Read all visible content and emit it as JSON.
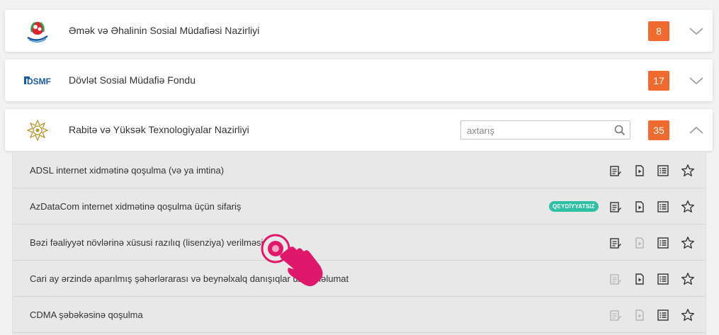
{
  "colors": {
    "badge": "#ef6a2e",
    "badge_tag": "#2ebfa5",
    "accent_pink": "#e0186c",
    "icon_gray": "#333333"
  },
  "organizations": [
    {
      "title": "Əmək və Əhalinin Sosial Müdafiəsi Nazirliyi",
      "count": "8",
      "expanded": false,
      "chevron": "chevron-down-icon"
    },
    {
      "title": "Dövlət Sosial Müdafiə Fondu",
      "count": "17",
      "expanded": false,
      "chevron": "chevron-down-icon",
      "logo_text": "DSMF"
    },
    {
      "title": "Rabitə və Yüksək Texnologiyalar Nazirliyi",
      "count": "35",
      "expanded": true,
      "chevron": "chevron-up-icon",
      "search": {
        "placeholder": "axtarış",
        "value": ""
      }
    }
  ],
  "services": [
    {
      "title": "ADSL internet xidmətinə qoşulma (və ya imtina)",
      "badge": "",
      "actions_enabled": [
        true,
        true,
        true,
        true
      ]
    },
    {
      "title": "AzDataCom internet xidmətinə qoşulma üçün sifariş",
      "badge": "QEYDİYYATSIZ",
      "actions_enabled": [
        true,
        true,
        true,
        true
      ]
    },
    {
      "title": "Bəzi fəaliyyət növlərinə xüsusi razılıq (lisenziya) verilməsi",
      "badge": "",
      "actions_enabled": [
        true,
        false,
        true,
        true
      ]
    },
    {
      "title": "Cari ay ərzində aparılmış şəhərlərarası və beynəlxalq danışıqlar üzrə məlumat",
      "badge": "",
      "actions_enabled": [
        false,
        true,
        true,
        true
      ]
    },
    {
      "title": "CDMA şəbəkəsinə qoşulma",
      "badge": "",
      "actions_enabled": [
        false,
        false,
        true,
        true
      ]
    }
  ],
  "action_icons": [
    "form-edit-icon",
    "video-play-icon",
    "list-icon",
    "star-icon"
  ]
}
